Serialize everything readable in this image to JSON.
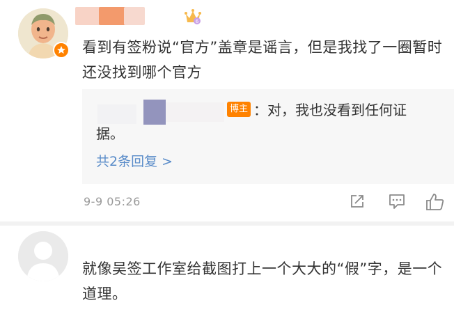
{
  "comments": [
    {
      "text": "看到有签粉说“官方”盖章是谣言，但是我找了一圈暂时还没找到哪个官方",
      "reply": {
        "author_tag": "博主",
        "text_line1": "：对，我也没看到任何证",
        "text_line2": "据。"
      },
      "more_replies": "共2条回复 >",
      "timestamp": "9-9 05:26",
      "icons": [
        "share-icon",
        "comment-icon",
        "like-icon"
      ],
      "colors": {
        "badge": "#ff8200",
        "link": "#5a8cc9",
        "meta": "#999999"
      }
    },
    {
      "text": "就像吴签工作室给截图打上一个大大的“假”字，是一个道理。"
    }
  ]
}
